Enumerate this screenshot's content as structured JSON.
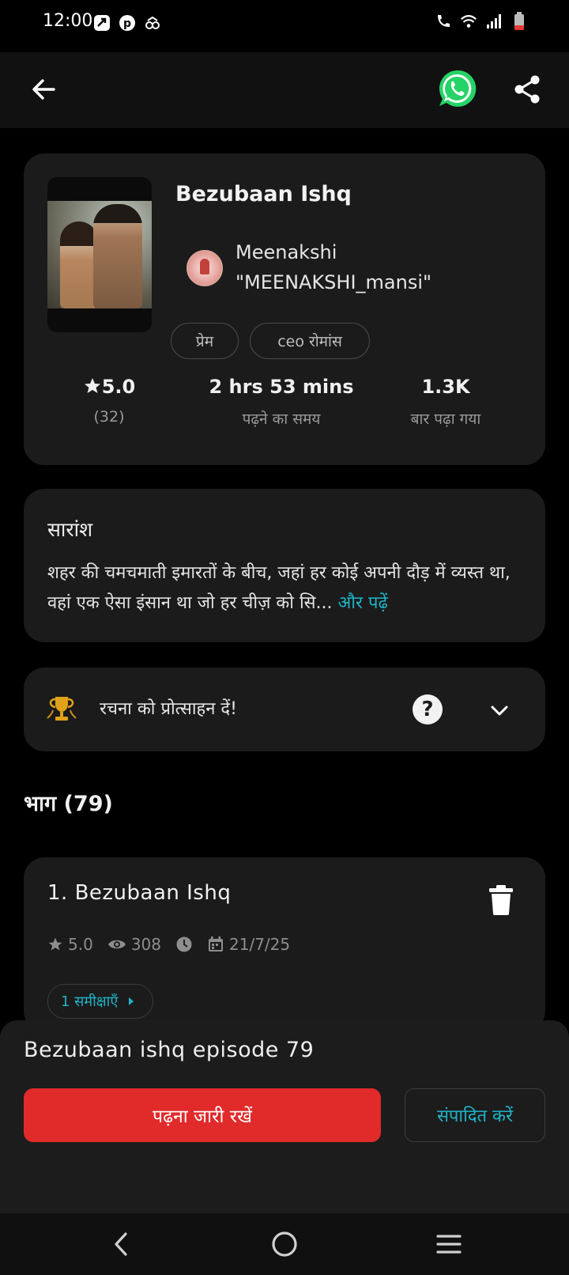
{
  "status_bar": {
    "time": "12:00",
    "left_icons": [
      "app-icon",
      "pinterest-icon",
      "notification-icon"
    ],
    "right_icons": [
      "wifi-call-icon",
      "wifi-icon",
      "signal-icon",
      "battery-icon"
    ]
  },
  "app_bar": {
    "actions": [
      "back-arrow-icon",
      "whatsapp-icon",
      "share-icon"
    ]
  },
  "book": {
    "title": "Bezubaan Ishq",
    "author_line1": "Meenakshi",
    "author_line2": "\"MEENAKSHI_mansi\"",
    "tags": [
      "प्रेम",
      "ceo रोमांस"
    ],
    "rating": "5.0",
    "rating_count": "(32)",
    "read_time": "2 hrs 53 mins",
    "read_time_label": "पढ़ने का समय",
    "reads": "1.3K",
    "reads_label": "बार पढ़ा गया"
  },
  "summary": {
    "heading": "सारांश",
    "text": "शहर की चमचमाती इमारतों के बीच, जहां हर कोई अपनी दौड़ में व्यस्त था, वहां एक ऐसा इंसान था जो हर चीज़ को सि...",
    "read_more": "और पढ़ें"
  },
  "support": {
    "text": "रचना को प्रोत्साहन दें!"
  },
  "parts": {
    "heading": "भाग (79)"
  },
  "episode": {
    "title": "1. Bezubaan Ishq",
    "rating": "5.0",
    "views": "308",
    "date": "21/7/25",
    "reviews": "1 समीक्षाएँ"
  },
  "bottom_sheet": {
    "title": "Bezubaan ishq episode 79",
    "continue_label": "पढ़ना जारी रखें",
    "edit_label": "संपादित करें"
  },
  "colors": {
    "accent_red": "#e12a2a",
    "link_teal": "#1fb4c8",
    "card_bg": "#1b1b1b",
    "whatsapp_green": "#25d366"
  }
}
